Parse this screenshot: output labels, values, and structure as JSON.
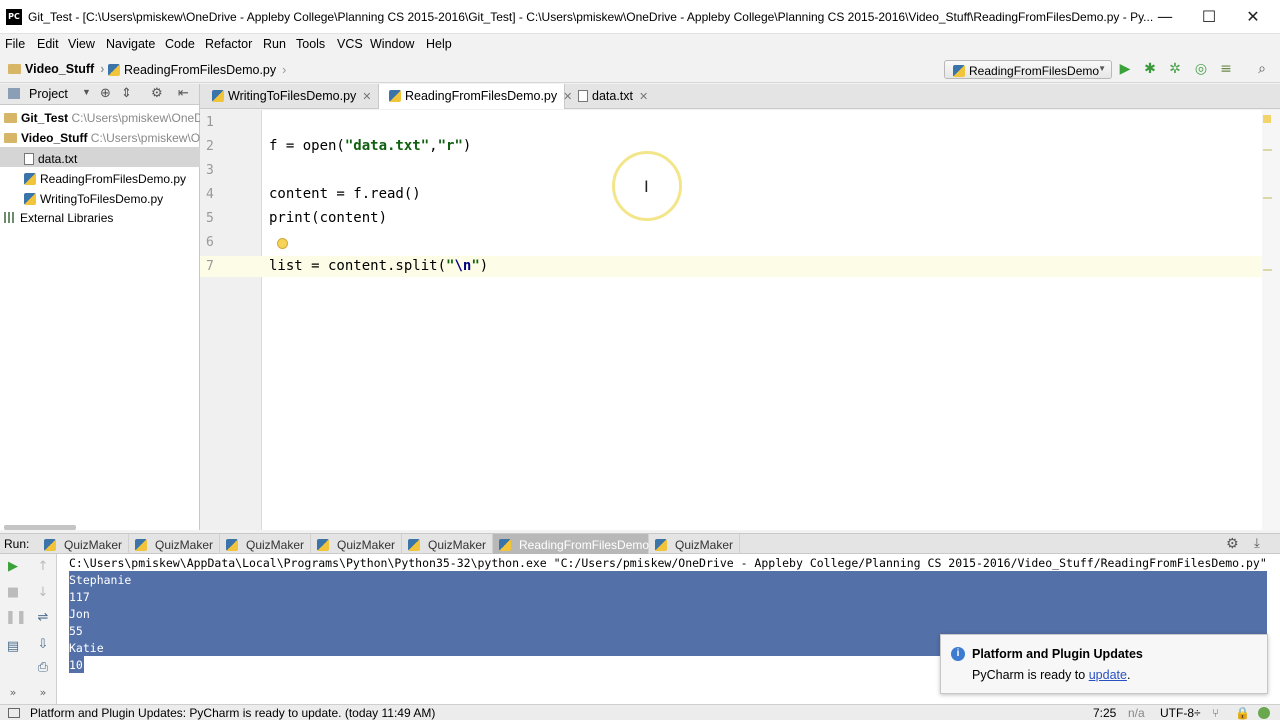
{
  "window": {
    "app_icon": "PC",
    "title": "Git_Test - [C:\\Users\\pmiskew\\OneDrive - Appleby College\\Planning CS 2015-2016\\Git_Test] - C:\\Users\\pmiskew\\OneDrive - Appleby College\\Planning CS 2015-2016\\Video_Stuff\\ReadingFromFilesDemo.py - Py...",
    "minimize": "—",
    "maximize": "☐",
    "close": "✕"
  },
  "menu": [
    "File",
    "Edit",
    "View",
    "Navigate",
    "Code",
    "Refactor",
    "Run",
    "Tools",
    "VCS",
    "Window",
    "Help"
  ],
  "breadcrumb": {
    "folder": "Video_Stuff",
    "file": "ReadingFromFilesDemo.py"
  },
  "toolbar": {
    "run_config": "ReadingFromFilesDemo",
    "icons": [
      "run-icon",
      "debug-icon",
      "run-coverage-icon",
      "profile-icon",
      "concurrency-icon",
      "search-icon"
    ]
  },
  "project_panel": {
    "label": "Project",
    "tree": [
      {
        "name": "Git_Test",
        "path": "C:\\Users\\pmiskew\\OneD",
        "type": "root"
      },
      {
        "name": "Video_Stuff",
        "path": "C:\\Users\\pmiskew\\O",
        "type": "root"
      },
      {
        "name": "data.txt",
        "path": "",
        "type": "txt"
      },
      {
        "name": "ReadingFromFilesDemo.py",
        "path": "",
        "type": "py"
      },
      {
        "name": "WritingToFilesDemo.py",
        "path": "",
        "type": "py"
      },
      {
        "name": "External Libraries",
        "path": "",
        "type": "lib"
      }
    ]
  },
  "editor_tabs": [
    {
      "label": "WritingToFilesDemo.py",
      "icon": "py-file-icon",
      "active": false
    },
    {
      "label": "ReadingFromFilesDemo.py",
      "icon": "py-file-icon",
      "active": true
    },
    {
      "label": "data.txt",
      "icon": "txt-file-icon",
      "active": false
    }
  ],
  "editor": {
    "line_numbers": [
      "1",
      "2",
      "3",
      "4",
      "5",
      "6",
      "7"
    ],
    "lines": [
      "",
      "f = open(\"data.txt\",\"r\")",
      "",
      "content = f.read()",
      "print(content)",
      "",
      "list = content.split(\"\\n\")"
    ],
    "line2": {
      "a": "f = open(",
      "s1": "\"data.txt\"",
      "comma": ",",
      "s2": "\"r\"",
      "b": ")"
    },
    "line4": "content = f.read()",
    "line5": "print(content)",
    "line7": {
      "a": "list = content.split(",
      "q1": "\"",
      "esc": "\\n",
      "q2": "\"",
      "b": ")"
    }
  },
  "run_panel": {
    "label": "Run:",
    "tabs": [
      "QuizMaker",
      "QuizMaker",
      "QuizMaker",
      "QuizMaker",
      "QuizMaker",
      "ReadingFromFilesDemo",
      "QuizMaker"
    ],
    "active_tab": "ReadingFromFilesDemo",
    "command": "C:\\Users\\pmiskew\\AppData\\Local\\Programs\\Python\\Python35-32\\python.exe \"C:/Users/pmiskew/OneDrive - Appleby College/Planning CS 2015-2016/Video_Stuff/ReadingFromFilesDemo.py\"",
    "output": [
      "Stephanie",
      "117",
      "Jon",
      "55",
      "Katie",
      "10"
    ]
  },
  "notification": {
    "title": "Platform and Plugin Updates",
    "body_prefix": "PyCharm is ready to ",
    "link": "update",
    "body_suffix": "."
  },
  "status": {
    "message": "Platform and Plugin Updates: PyCharm is ready to update. (today 11:49 AM)",
    "position": "7:25",
    "line_sep": "n/a",
    "encoding": "UTF-8÷"
  },
  "colors": {
    "selection": "#5470a8",
    "current_line": "#fdfce6",
    "string": "#106010",
    "link": "#2a51c2"
  }
}
